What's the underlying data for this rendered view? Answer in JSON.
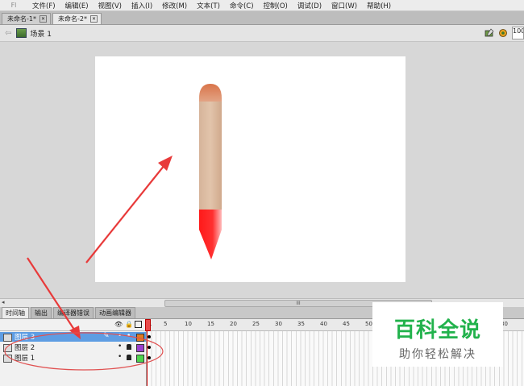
{
  "menubar": {
    "logo": "Fl",
    "items": [
      "文件(F)",
      "编辑(E)",
      "视图(V)",
      "插入(I)",
      "修改(M)",
      "文本(T)",
      "命令(C)",
      "控制(O)",
      "调试(D)",
      "窗口(W)",
      "帮助(H)"
    ]
  },
  "doc_tabs": [
    {
      "label": "未命名-1*",
      "active": false
    },
    {
      "label": "未命名-2*",
      "active": true
    }
  ],
  "edit_bar": {
    "scene_label": "场景 1",
    "zoom": "100"
  },
  "hscroll": {
    "thumb_glyph": "III"
  },
  "panel_tabs": [
    "时间轴",
    "输出",
    "编译器错误",
    "动画编辑器"
  ],
  "timeline": {
    "ruler_numbers": [
      "1",
      "5",
      "10",
      "15",
      "20",
      "25",
      "30",
      "35",
      "40",
      "45",
      "50",
      "55",
      "60",
      "65",
      "70",
      "75",
      "80"
    ],
    "layers": [
      {
        "name": "图层 3",
        "selected": true,
        "color": "#e07a20"
      },
      {
        "name": "图层 2",
        "selected": false,
        "color": "#9b3fcf"
      },
      {
        "name": "图层 1",
        "selected": false,
        "color": "#4cd44c"
      }
    ],
    "current_frame": 1
  },
  "watermark": {
    "title": "百科全说",
    "subtitle": "助你轻松解决"
  },
  "colors": {
    "annotation_red": "#e83a3a",
    "selected_layer": "#5e9de3",
    "watermark_green": "#22b24c"
  }
}
